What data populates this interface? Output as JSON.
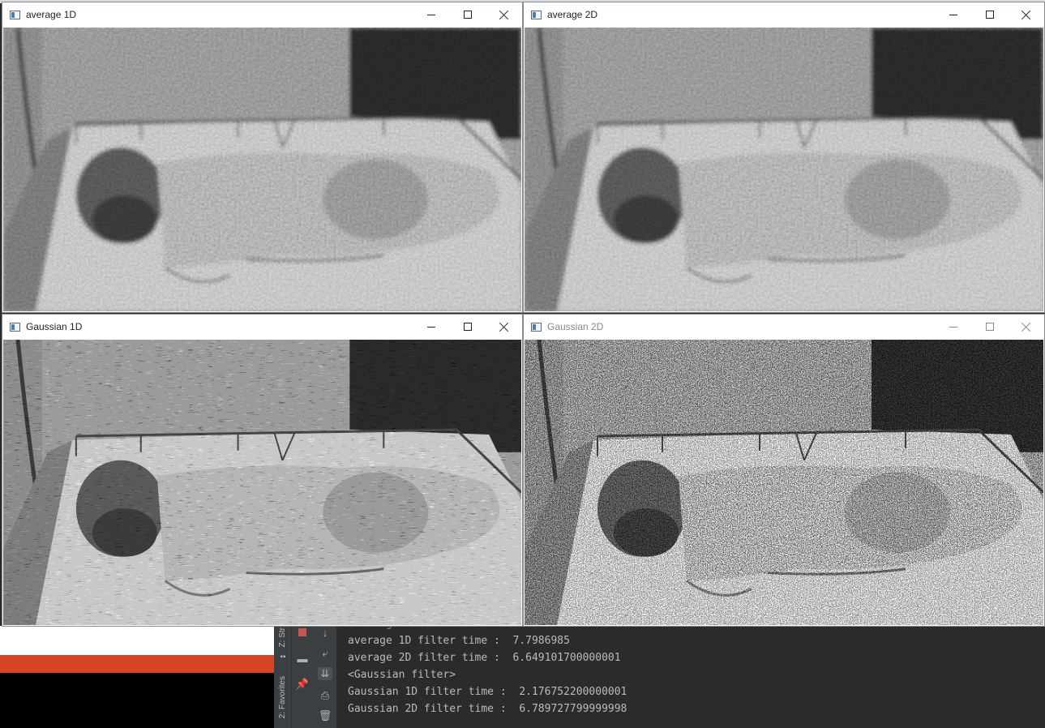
{
  "windows": {
    "avg1d": {
      "title": "average 1D",
      "noise": "avg",
      "active": true
    },
    "avg2d": {
      "title": "average 2D",
      "noise": "avg",
      "active": true
    },
    "gauss1d": {
      "title": "Gaussian 1D",
      "noise": "hstreak",
      "active": true
    },
    "gauss2d": {
      "title": "Gaussian 2D",
      "noise": "speckle",
      "active": false
    }
  },
  "ide": {
    "structure_tab": "Z: Str",
    "favorites_tab": "2: Favorites",
    "console_lines": [
      "<average filter>",
      "average 1D filter time :  7.7986985",
      "average 2D filter time :  6.649101700000001",
      "<Gaussian filter>",
      "Gaussian 1D filter time :  2.176752200000001",
      "Gaussian 2D filter time :  6.789727799999998"
    ]
  },
  "colors": {
    "ide_bg": "#2b2b2b",
    "ide_toolbar": "#3c3f41",
    "console_text": "#bbbbbb",
    "taskbar_accent": "#d64523"
  }
}
